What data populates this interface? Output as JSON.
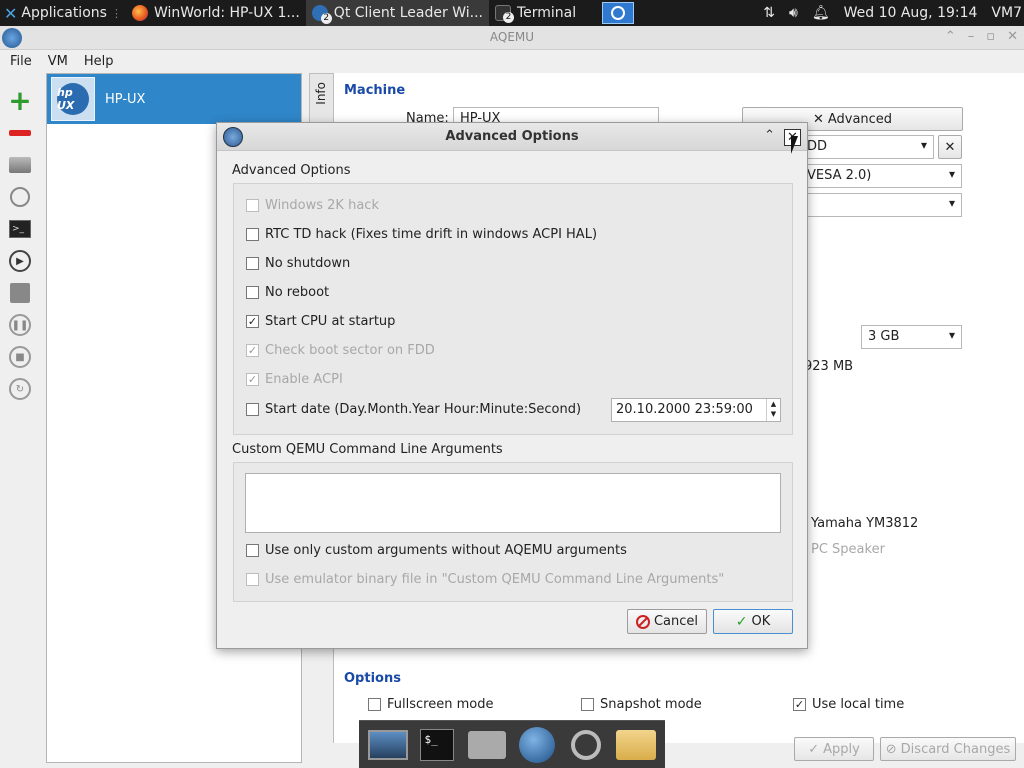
{
  "taskbar": {
    "applications": "Applications",
    "tasks": [
      {
        "label": "WinWorld: HP-UX 1...",
        "icon": "firefox-icon"
      },
      {
        "label": "Qt Client Leader Wi...",
        "icon": "qt-icon",
        "badge": "2"
      },
      {
        "label": "Terminal",
        "icon": "terminal-icon",
        "badge": "2"
      }
    ],
    "clock": "Wed 10 Aug, 19:14",
    "user": "VM7"
  },
  "window": {
    "title": "AQEMU",
    "menu": [
      "File",
      "VM",
      "Help"
    ]
  },
  "vm_list": {
    "selected": {
      "name": "HP-UX",
      "logo_text": "hp UX"
    }
  },
  "side_tab": "Info",
  "machine": {
    "section_title": "Machine",
    "name_label": "Name:",
    "name_value": "HP-UX",
    "advanced_button": "Advanced",
    "combo1": "DD",
    "combo2": "VESA 2.0)",
    "memory_value": "3 GB",
    "memory_free": "923 MB",
    "sound1": "Yamaha YM3812",
    "sound2": "PC Speaker"
  },
  "options": {
    "section_title": "Options",
    "fullscreen": "Fullscreen mode",
    "snapshot": "Snapshot mode",
    "local_time": "Use local time"
  },
  "bottom_buttons": {
    "apply": "Apply",
    "discard": "Discard Changes"
  },
  "dialog": {
    "title": "Advanced Options",
    "group1_label": "Advanced Options",
    "checkboxes": [
      {
        "label": "Windows 2K hack",
        "checked": false,
        "disabled": true
      },
      {
        "label": "RTC TD hack (Fixes time drift in windows ACPI HAL)",
        "checked": false,
        "disabled": false
      },
      {
        "label": "No shutdown",
        "checked": false,
        "disabled": false
      },
      {
        "label": "No reboot",
        "checked": false,
        "disabled": false
      },
      {
        "label": "Start CPU at startup",
        "checked": true,
        "disabled": false
      },
      {
        "label": "Check boot sector on FDD",
        "checked": true,
        "disabled": true
      },
      {
        "label": "Enable ACPI",
        "checked": true,
        "disabled": true
      },
      {
        "label": "Start date (Day.Month.Year Hour:Minute:Second)",
        "checked": false,
        "disabled": false
      }
    ],
    "start_date_value": "20.10.2000 23:59:00",
    "group2_label": "Custom QEMU Command Line Arguments",
    "custom_args_value": "",
    "custom_checks": [
      {
        "label": "Use only custom arguments without AQEMU arguments",
        "checked": false,
        "disabled": false
      },
      {
        "label": "Use emulator binary file in \"Custom QEMU Command Line Arguments\"",
        "checked": false,
        "disabled": true
      }
    ],
    "cancel": "Cancel",
    "ok": "OK"
  }
}
